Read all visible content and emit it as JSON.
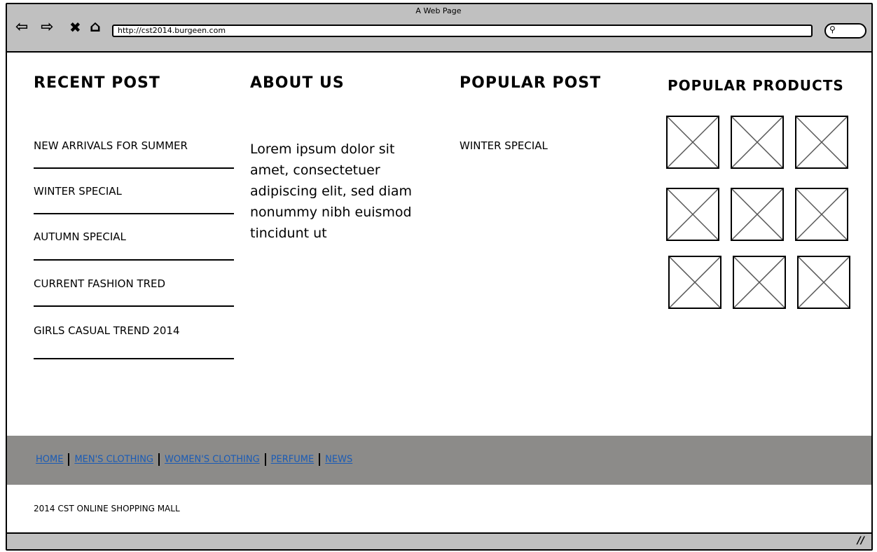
{
  "browser": {
    "title": "A Web Page",
    "url": "http://cst2014.burgeen.com"
  },
  "recent_post": {
    "heading": "RECENT POST",
    "items": [
      "NEW ARRIVALS FOR SUMMER",
      "WINTER SPECIAL",
      "AUTUMN SPECIAL",
      "CURRENT FASHION TRED",
      "GIRLS CASUAL TREND 2014"
    ]
  },
  "about_us": {
    "heading": "ABOUT US",
    "text": "Lorem ipsum dolor sit amet, consectetuer adipiscing elit, sed diam nonummy nibh euismod tincidunt ut"
  },
  "popular_post": {
    "heading": "POPULAR POST",
    "items": [
      "WINTER SPECIAL"
    ]
  },
  "popular_products": {
    "heading": "POPULAR PRODUCTS",
    "count": 9
  },
  "footer": {
    "links": [
      "HOME",
      "MEN'S CLOTHING",
      "WOMEN'S CLOTHING",
      "PERFUME",
      "NEWS"
    ],
    "copyright": "2014 CST ONLINE SHOPPING MALL"
  },
  "colors": {
    "chrome": "#c0c0c0",
    "footer": "#8c8b89",
    "link": "#1a5bb5"
  }
}
